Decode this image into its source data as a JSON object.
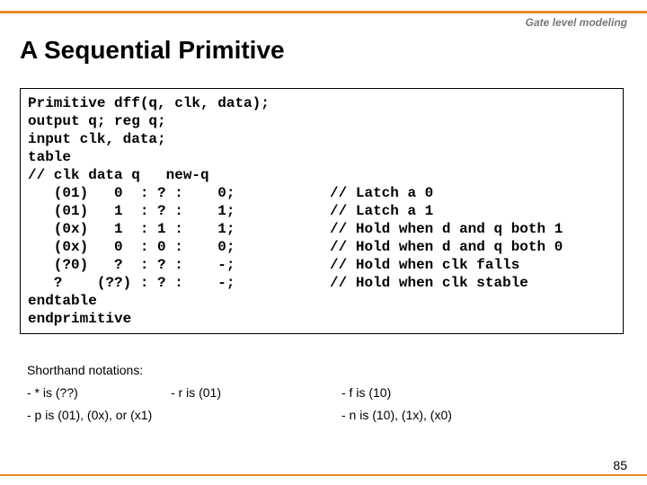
{
  "header": {
    "section_label": "Gate level modeling",
    "title": "A Sequential Primitive"
  },
  "code": {
    "lines": [
      "Primitive dff(q, clk, data);",
      "output q; reg q;",
      "input clk, data;",
      "table",
      "// clk data q   new-q",
      "   (01)   0  : ? :    0;           // Latch a 0",
      "   (01)   1  : ? :    1;           // Latch a 1",
      "   (0x)   1  : 1 :    1;           // Hold when d and q both 1",
      "   (0x)   0  : 0 :    0;           // Hold when d and q both 0",
      "   (?0)   ?  : ? :    -;           // Hold when clk falls",
      "   ?    (??) : ? :    -;           // Hold when clk stable",
      "endtable",
      "endprimitive"
    ]
  },
  "shorthand": {
    "heading": "Shorthand notations:",
    "row1_col1": "- * is (??)",
    "row1_col2": "- r is (01)",
    "row1_col3": "-  f is (10)",
    "row2_col1": "- p is (01), (0x), or (x1)",
    "row2_col3": "-  n is (10), (1x), (x0)"
  },
  "page_number": "85"
}
